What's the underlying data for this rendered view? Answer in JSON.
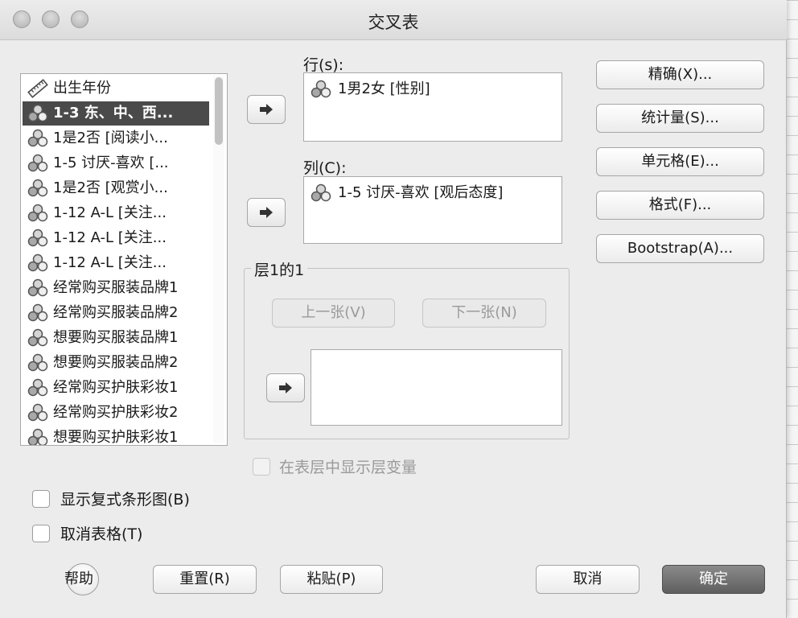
{
  "window": {
    "title": "交叉表"
  },
  "variables": {
    "items": [
      {
        "label": "出生年份",
        "icon": "ruler-icon",
        "selected": false
      },
      {
        "label": "1-3 东、中、西...",
        "icon": "nominal-variable-icon",
        "selected": true
      },
      {
        "label": "1是2否 [阅读小...",
        "icon": "nominal-variable-icon",
        "selected": false
      },
      {
        "label": "1-5 讨厌-喜欢 [...",
        "icon": "nominal-variable-icon",
        "selected": false
      },
      {
        "label": "1是2否 [观赏小...",
        "icon": "nominal-variable-icon",
        "selected": false
      },
      {
        "label": "1-12 A-L [关注...",
        "icon": "nominal-variable-icon",
        "selected": false
      },
      {
        "label": "1-12 A-L [关注...",
        "icon": "nominal-variable-icon",
        "selected": false
      },
      {
        "label": "1-12 A-L [关注...",
        "icon": "nominal-variable-icon",
        "selected": false
      },
      {
        "label": "经常购买服装品牌1",
        "icon": "nominal-variable-icon",
        "selected": false
      },
      {
        "label": "经常购买服装品牌2",
        "icon": "nominal-variable-icon",
        "selected": false
      },
      {
        "label": "想要购买服装品牌1",
        "icon": "nominal-variable-icon",
        "selected": false
      },
      {
        "label": "想要购买服装品牌2",
        "icon": "nominal-variable-icon",
        "selected": false
      },
      {
        "label": "经常购买护肤彩妆1",
        "icon": "nominal-variable-icon",
        "selected": false
      },
      {
        "label": "经常购买护肤彩妆2",
        "icon": "nominal-variable-icon",
        "selected": false
      },
      {
        "label": "想要购买护肤彩妆1",
        "icon": "nominal-variable-icon",
        "selected": false
      }
    ]
  },
  "rows": {
    "label": "行(s):",
    "items": [
      "1男2女 [性别]"
    ]
  },
  "columns": {
    "label": "列(C):",
    "items": [
      "1-5 讨厌-喜欢 [观后态度]"
    ]
  },
  "layer": {
    "label": "层1的1",
    "prev_label": "上一张(V)",
    "next_label": "下一张(N)",
    "show_layer_vars_label": "在表层中显示层变量"
  },
  "side_buttons": {
    "exact": "精确(X)...",
    "statistics": "统计量(S)...",
    "cells": "单元格(E)...",
    "format": "格式(F)...",
    "bootstrap": "Bootstrap(A)..."
  },
  "options": {
    "clustered_bar": "显示复式条形图(B)",
    "suppress_tables": "取消表格(T)"
  },
  "footer": {
    "help": "帮助",
    "reset": "重置(R)",
    "paste": "粘贴(P)",
    "cancel": "取消",
    "ok": "确定"
  }
}
